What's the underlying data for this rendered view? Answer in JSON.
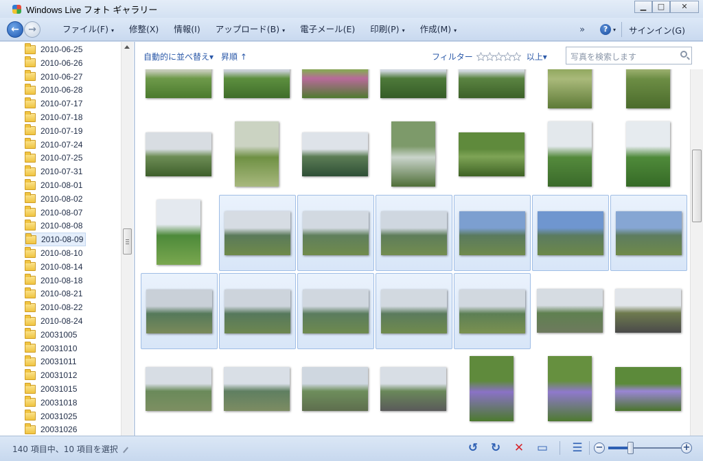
{
  "window": {
    "title": "Windows Live フォト ギャラリー",
    "buttons": [
      "▁",
      "□",
      "✕"
    ]
  },
  "menubar": {
    "items": [
      {
        "label": "ファイル(F)",
        "caret": true
      },
      {
        "label": "修整(X)",
        "caret": false
      },
      {
        "label": "情報(I)",
        "caret": false
      },
      {
        "label": "アップロード(B)",
        "caret": true
      },
      {
        "label": "電子メール(E)",
        "caret": false
      },
      {
        "label": "印刷(P)",
        "caret": true
      },
      {
        "label": "作成(M)",
        "caret": true
      }
    ],
    "more": "»",
    "help": "?",
    "signin": "サインイン(G)"
  },
  "folders": {
    "selected_index": 14,
    "items": [
      "2010-06-25",
      "2010-06-26",
      "2010-06-27",
      "2010-06-28",
      "2010-07-17",
      "2010-07-18",
      "2010-07-19",
      "2010-07-24",
      "2010-07-25",
      "2010-07-31",
      "2010-08-01",
      "2010-08-02",
      "2010-08-07",
      "2010-08-08",
      "2010-08-09",
      "2010-08-10",
      "2010-08-14",
      "2010-08-18",
      "2010-08-21",
      "2010-08-22",
      "2010-08-24",
      "20031005",
      "20031010",
      "20031011",
      "20031012",
      "20031015",
      "20031018",
      "20031025",
      "20031026"
    ]
  },
  "toolbar": {
    "sort_label": "自動的に並べ替え",
    "sort_caret": "▾",
    "order_label": "昇順",
    "order_arrow": "↑",
    "filter_label": "フィルター",
    "rating": 0,
    "rating_max": 5,
    "filter_scope": "以上",
    "filter_caret": "▾",
    "search_placeholder": "写真を検索します"
  },
  "photos": {
    "rows": [
      [
        {
          "kind": "landscape",
          "selected": false,
          "colors": [
            "#c5cbb8",
            "#6e9a4a",
            "#4b7a2e"
          ]
        },
        {
          "kind": "landscape",
          "selected": false,
          "colors": [
            "#c9cfd6",
            "#5d8f3f",
            "#3f6d2a"
          ]
        },
        {
          "kind": "landscape",
          "selected": false,
          "colors": [
            "#8aa45a",
            "#b86a9a",
            "#4f7a30"
          ]
        },
        {
          "kind": "landscape",
          "selected": false,
          "colors": [
            "#cfd6de",
            "#4e7a3a",
            "#355c27"
          ]
        },
        {
          "kind": "landscape",
          "selected": false,
          "colors": [
            "#d3d9df",
            "#5b8442",
            "#3c6128"
          ]
        },
        {
          "kind": "portrait",
          "selected": false,
          "colors": [
            "#8ea65c",
            "#a9b97a",
            "#5d7a36"
          ]
        },
        {
          "kind": "portrait",
          "selected": false,
          "colors": [
            "#a3b576",
            "#6c8d44",
            "#4b6b2c"
          ]
        }
      ],
      [
        {
          "kind": "landscape",
          "selected": false,
          "colors": [
            "#d8dde2",
            "#6d8d55",
            "#3e5f2b"
          ]
        },
        {
          "kind": "portrait",
          "selected": false,
          "colors": [
            "#cbd3c2",
            "#6f9144",
            "#a8b87e"
          ]
        },
        {
          "kind": "landscape",
          "selected": false,
          "colors": [
            "#dee3e9",
            "#5c7d55",
            "#2e4f36"
          ]
        },
        {
          "kind": "portrait",
          "selected": false,
          "colors": [
            "#7d9a6a",
            "#c9d4cb",
            "#4f6e37"
          ]
        },
        {
          "kind": "landscape",
          "selected": false,
          "colors": [
            "#5f8a3c",
            "#7ea456",
            "#3e6224"
          ]
        },
        {
          "kind": "portrait",
          "selected": false,
          "colors": [
            "#e3e8ec",
            "#548a3c",
            "#3a6a2a"
          ]
        },
        {
          "kind": "portrait",
          "selected": false,
          "colors": [
            "#e6ebef",
            "#4f8a3a",
            "#356a26"
          ]
        }
      ],
      [
        {
          "kind": "portrait",
          "selected": false,
          "colors": [
            "#e4e9ef",
            "#4d8a3a",
            "#7aa74f"
          ]
        },
        {
          "kind": "landscape",
          "selected": true,
          "colors": [
            "#d6dce3",
            "#5a7a5a",
            "#6f8a4a"
          ]
        },
        {
          "kind": "landscape",
          "selected": true,
          "colors": [
            "#d2d9e1",
            "#5f7f5c",
            "#708b4c"
          ]
        },
        {
          "kind": "landscape",
          "selected": true,
          "colors": [
            "#cfd7e0",
            "#5e7d5a",
            "#738d4f"
          ]
        },
        {
          "kind": "landscape",
          "selected": true,
          "colors": [
            "#7c9fd0",
            "#5a7a5e",
            "#6f8a4c"
          ]
        },
        {
          "kind": "landscape",
          "selected": true,
          "colors": [
            "#6f96cf",
            "#5b7b60",
            "#6c8849"
          ]
        },
        {
          "kind": "landscape",
          "selected": true,
          "colors": [
            "#86a6d3",
            "#5d7c5f",
            "#6f8a4a"
          ]
        }
      ],
      [
        {
          "kind": "landscape",
          "selected": true,
          "colors": [
            "#c9d0d8",
            "#55795a",
            "#7a8a5a"
          ]
        },
        {
          "kind": "landscape",
          "selected": true,
          "colors": [
            "#cdd4dc",
            "#56785c",
            "#6d8750"
          ]
        },
        {
          "kind": "landscape",
          "selected": true,
          "colors": [
            "#d0d7df",
            "#5a7c5e",
            "#6e8a4e"
          ]
        },
        {
          "kind": "landscape",
          "selected": true,
          "colors": [
            "#d2d9e0",
            "#5b7b5d",
            "#708b4d"
          ]
        },
        {
          "kind": "landscape",
          "selected": true,
          "colors": [
            "#d1d8df",
            "#5d7f55",
            "#7a9150"
          ]
        },
        {
          "kind": "landscape",
          "selected": false,
          "colors": [
            "#d6dce2",
            "#5f8050",
            "#6e7a5e"
          ]
        },
        {
          "kind": "landscape",
          "selected": false,
          "colors": [
            "#e1e5ea",
            "#6e7a4e",
            "#4a4a4a"
          ]
        }
      ],
      [
        {
          "kind": "landscape",
          "selected": false,
          "colors": [
            "#d7dde4",
            "#6a8a5a",
            "#7d8f62"
          ]
        },
        {
          "kind": "landscape",
          "selected": false,
          "colors": [
            "#d9dfe6",
            "#5f7f61",
            "#7c8c62"
          ]
        },
        {
          "kind": "landscape",
          "selected": false,
          "colors": [
            "#cfd7e0",
            "#6e8e5c",
            "#5e6e4e"
          ]
        },
        {
          "kind": "landscape",
          "selected": false,
          "colors": [
            "#d8dee5",
            "#6a885a",
            "#5a5a5a"
          ]
        },
        {
          "kind": "portrait",
          "selected": false,
          "colors": [
            "#5f8a3c",
            "#8a72c6",
            "#4c7a2e"
          ]
        },
        {
          "kind": "portrait",
          "selected": false,
          "colors": [
            "#66903f",
            "#8f79cc",
            "#4e7a30"
          ]
        },
        {
          "kind": "landscape",
          "selected": false,
          "colors": [
            "#5c8a3a",
            "#9a86d4",
            "#4a752c"
          ]
        }
      ]
    ]
  },
  "statusbar": {
    "text": "140 項目中、10 項目を選択",
    "rotate_left": "↺",
    "rotate_right": "↻",
    "delete": "✕",
    "slideshow": "▭",
    "view_toggle": "☰",
    "zoom_out": "−",
    "zoom_in": "+",
    "zoom_level": 0.3,
    "accent": "#2d5fb3",
    "delete_color": "#d6242a"
  }
}
